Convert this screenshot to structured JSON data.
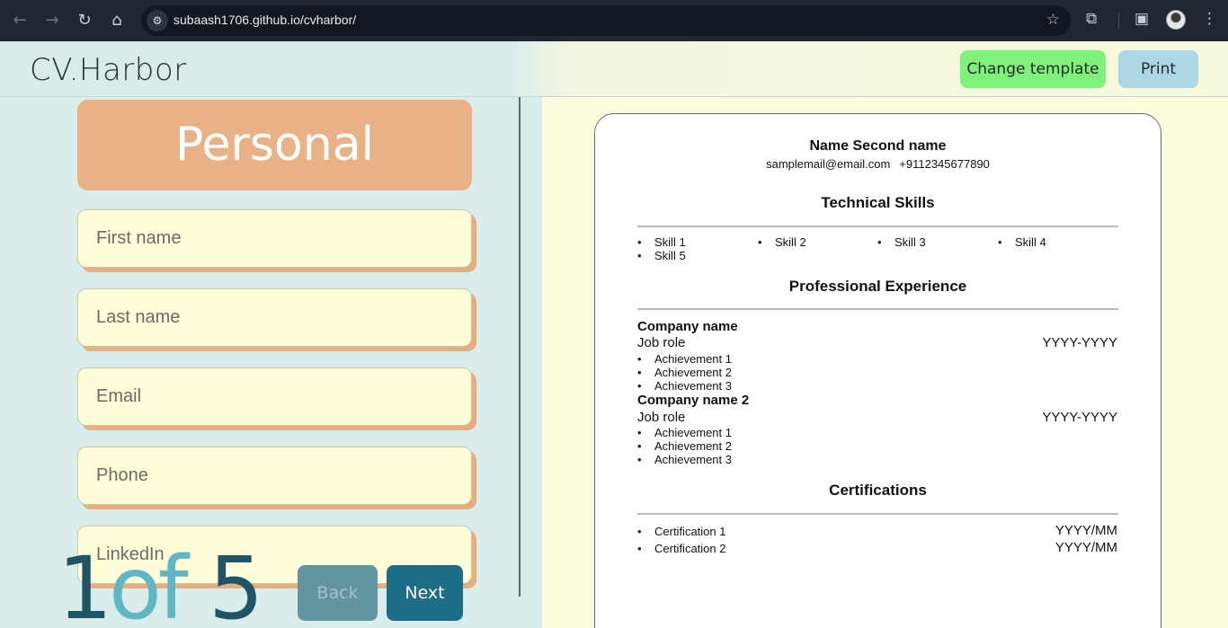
{
  "browser": {
    "url": "subaash1706.github.io/cvharbor/",
    "back_icon": "arrow-left-icon",
    "forward_icon": "arrow-right-icon",
    "reload_icon": "reload-icon",
    "home_icon": "home-icon",
    "star_icon": "star-icon",
    "extensions_icon": "puzzle-icon",
    "sidepanel_icon": "sidepanel-icon",
    "menu_icon": "kebab-menu-icon"
  },
  "header": {
    "logo": "CV.Harbor",
    "change_template_label": "Change template",
    "print_label": "Print",
    "colors": {
      "change_template": "#7ef27a",
      "print": "#acd8e6"
    }
  },
  "form": {
    "section_title": "Personal",
    "fields": [
      {
        "placeholder": "First name"
      },
      {
        "placeholder": "Last name"
      },
      {
        "placeholder": "Email"
      },
      {
        "placeholder": "Phone"
      },
      {
        "placeholder": "LinkedIn"
      }
    ],
    "step": {
      "current": "1",
      "of": "of",
      "total": "5"
    },
    "back_label": "Back",
    "next_label": "Next"
  },
  "preview": {
    "name": "Name Second name",
    "email": "samplemail@email.com",
    "phone": "+9112345677890",
    "skills_heading": "Technical Skills",
    "skills": [
      "Skill 1",
      "Skill 2",
      "Skill 3",
      "Skill 4",
      "Skill 5"
    ],
    "experience_heading": "Professional Experience",
    "experience": [
      {
        "company": "Company name",
        "role": "Job role",
        "dates": "YYYY-YYYY",
        "achievements": [
          "Achievement 1",
          "Achievement 2",
          "Achievement 3"
        ]
      },
      {
        "company": "Company name 2",
        "role": "Job role",
        "dates": "YYYY-YYYY",
        "achievements": [
          "Achievement 1",
          "Achievement 2",
          "Achievement 3"
        ]
      }
    ],
    "certifications_heading": "Certifications",
    "certifications": [
      {
        "name": "Certification 1",
        "date": "YYYY/MM"
      },
      {
        "name": "Certification 2",
        "date": "YYYY/MM"
      }
    ]
  }
}
